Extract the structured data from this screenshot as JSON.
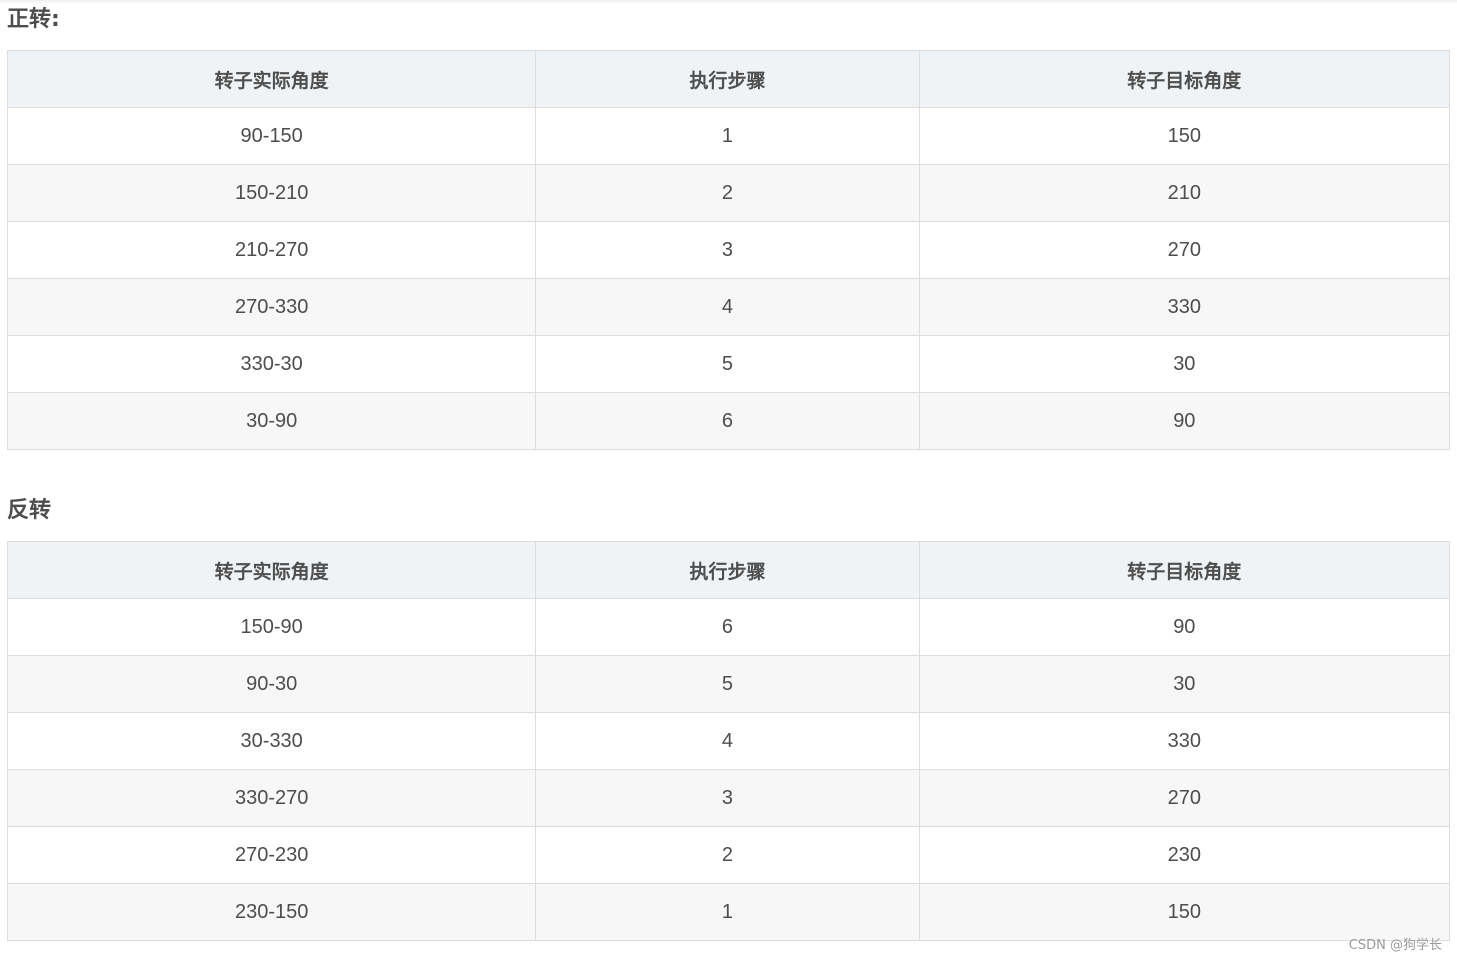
{
  "sections": [
    {
      "title": "正转:",
      "headers": [
        "转子实际角度",
        "执行步骤",
        "转子目标角度"
      ],
      "rows": [
        [
          "90-150",
          "1",
          "150"
        ],
        [
          "150-210",
          "2",
          "210"
        ],
        [
          "210-270",
          "3",
          "270"
        ],
        [
          "270-330",
          "4",
          "330"
        ],
        [
          "330-30",
          "5",
          "30"
        ],
        [
          "30-90",
          "6",
          "90"
        ]
      ]
    },
    {
      "title": "反转",
      "headers": [
        "转子实际角度",
        "执行步骤",
        "转子目标角度"
      ],
      "rows": [
        [
          "150-90",
          "6",
          "90"
        ],
        [
          "90-30",
          "5",
          "30"
        ],
        [
          "30-330",
          "4",
          "330"
        ],
        [
          "330-270",
          "3",
          "270"
        ],
        [
          "270-230",
          "2",
          "230"
        ],
        [
          "230-150",
          "1",
          "150"
        ]
      ]
    }
  ],
  "watermark": "CSDN @狗学长"
}
